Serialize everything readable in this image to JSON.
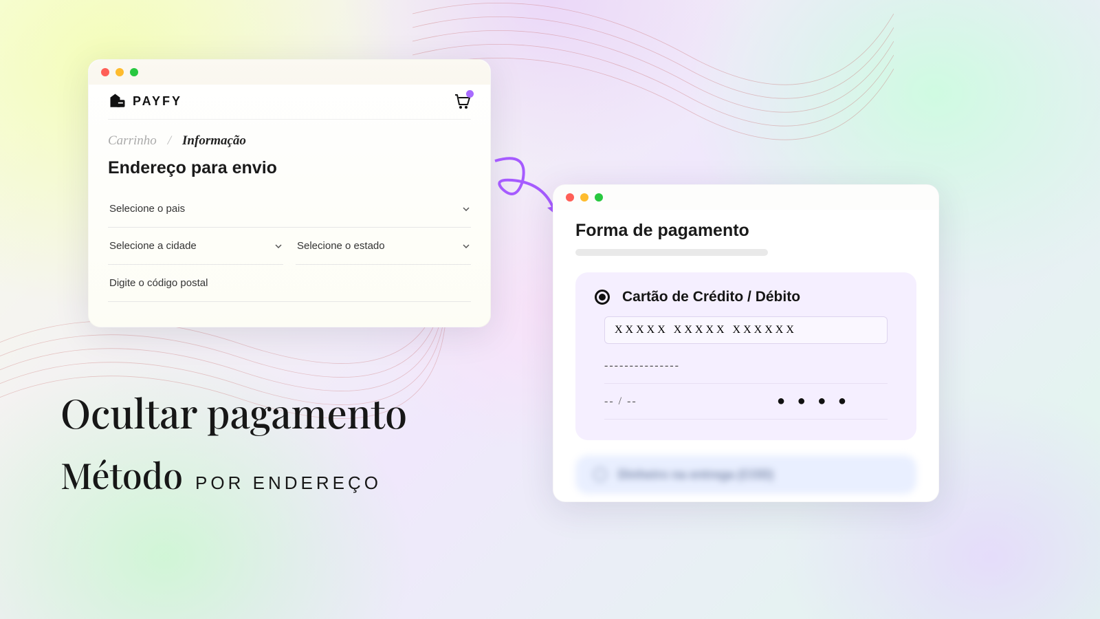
{
  "brand": {
    "name": "PAYFY"
  },
  "breadcrumb": {
    "cart": "Carrinho",
    "sep": "/",
    "info": "Informação"
  },
  "address": {
    "title": "Endereço para envio",
    "country_ph": "Selecione o pais",
    "city_ph": "Selecione a cidade",
    "state_ph": "Selecione o estado",
    "postal_ph": "Digite o código postal"
  },
  "payment": {
    "title": "Forma de pagamento",
    "card_label": "Cartão de Crédito / Débito",
    "card_number_mask": "XXXXX XXXXX XXXXXX",
    "name_mask": "---------------",
    "expiry_mask": "-- / --",
    "cvv_mask": "● ● ● ●",
    "hidden_label": "Dinheiro na entrega (COD)"
  },
  "headline": {
    "line1": "Ocultar pagamento",
    "line2a": "Método",
    "line2b": "por endereço"
  }
}
